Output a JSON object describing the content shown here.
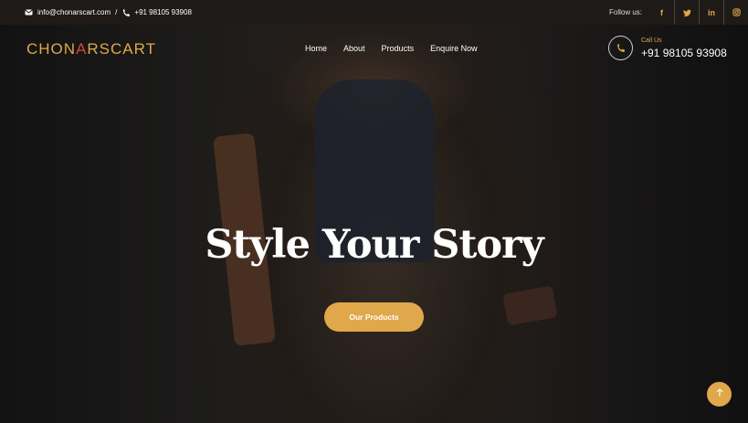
{
  "topbar": {
    "email": "info@chonarscart.com",
    "separator": "/",
    "phone": "+91 98105 93908",
    "follow_label": "Follow us:",
    "social": [
      {
        "icon": "facebook-icon",
        "glyph": "f"
      },
      {
        "icon": "twitter-icon",
        "glyph": "t"
      },
      {
        "icon": "linkedin-icon",
        "glyph": "in"
      },
      {
        "icon": "instagram-icon",
        "glyph": "◎"
      }
    ]
  },
  "header": {
    "logo_part1": "CHON",
    "logo_accent": "A",
    "logo_part2": "RSCART",
    "nav": [
      "Home",
      "About",
      "Products",
      "Enquire Now"
    ],
    "call_label": "Call Us",
    "call_number": "+91 98105 93908"
  },
  "hero": {
    "headline": "Style Your Story",
    "cta_label": "Our Products"
  },
  "colors": {
    "accent": "#e0a84a",
    "topbar_bg": "#1e1a18"
  }
}
